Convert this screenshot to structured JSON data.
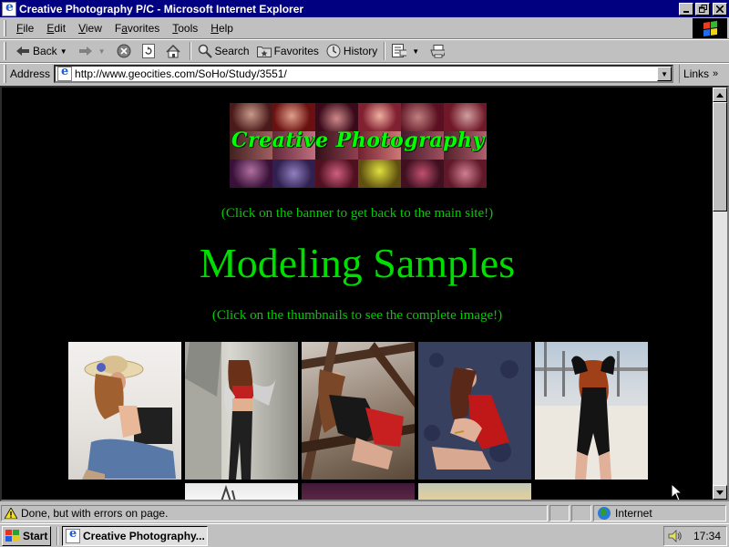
{
  "window": {
    "title": "Creative Photography P/C - Microsoft Internet Explorer"
  },
  "menu": [
    {
      "label": "File",
      "key": "F"
    },
    {
      "label": "Edit",
      "key": "E"
    },
    {
      "label": "View",
      "key": "V"
    },
    {
      "label": "Favorites",
      "key": "a"
    },
    {
      "label": "Tools",
      "key": "T"
    },
    {
      "label": "Help",
      "key": "H"
    }
  ],
  "toolbar": {
    "back_label": "Back",
    "search_label": "Search",
    "favorites_label": "Favorites",
    "history_label": "History"
  },
  "address": {
    "label": "Address",
    "url": "http://www.geocities.com/SoHo/Study/3551/",
    "links_label": "Links"
  },
  "page": {
    "banner_text": "Creative Photography P/C",
    "banner_note": "(Click on the banner to get back to the main site!)",
    "heading": "Modeling Samples",
    "thumbs_note": "(Click on the thumbnails to see the complete image!)",
    "thumbnails": [
      {
        "name": "thumb-model-straw-hat"
      },
      {
        "name": "thumb-model-silver-jacket"
      },
      {
        "name": "thumb-model-metal-structure"
      },
      {
        "name": "thumb-model-red-dress"
      },
      {
        "name": "thumb-model-black-bodysuit"
      },
      {
        "name": "thumb-row2-1"
      },
      {
        "name": "thumb-row2-2"
      },
      {
        "name": "thumb-row2-3"
      }
    ]
  },
  "status": {
    "message": "Done, but with errors on page.",
    "zone": "Internet"
  },
  "taskbar": {
    "start_label": "Start",
    "task_label": "Creative Photography...",
    "clock": "17:34"
  },
  "colors": {
    "titlebar": "#000080",
    "page_bg": "#000000",
    "page_text": "#00cc00"
  }
}
